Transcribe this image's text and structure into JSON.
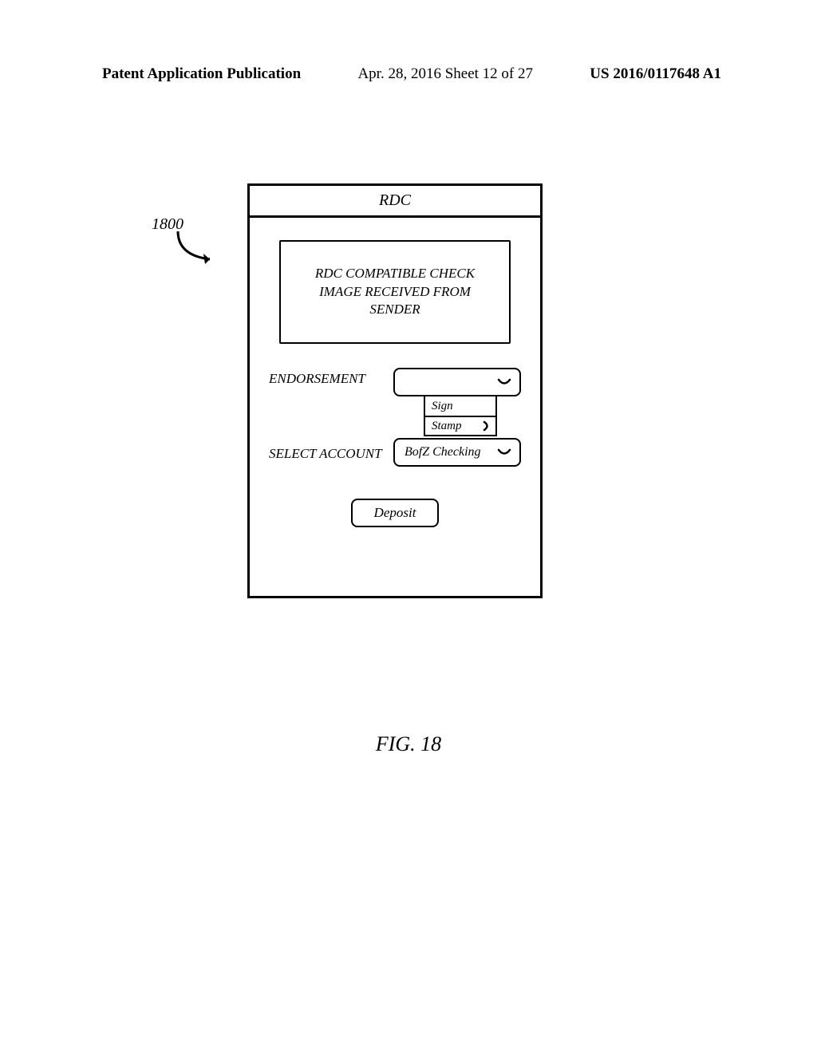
{
  "header": {
    "left": "Patent Application Publication",
    "center": "Apr. 28, 2016  Sheet 12 of 27",
    "right": "US 2016/0117648 A1"
  },
  "ref_label": "1800",
  "app": {
    "title": "RDC",
    "check_image_text": "RDC COMPATIBLE CHECK IMAGE RECEIVED FROM SENDER",
    "endorsement_label": "ENDORSEMENT",
    "endorsement_options": {
      "sign": "Sign",
      "stamp": "Stamp"
    },
    "select_account_label": "SELECT ACCOUNT",
    "account_value": "BofZ Checking",
    "deposit_label": "Deposit"
  },
  "figure_caption": "FIG. 18"
}
